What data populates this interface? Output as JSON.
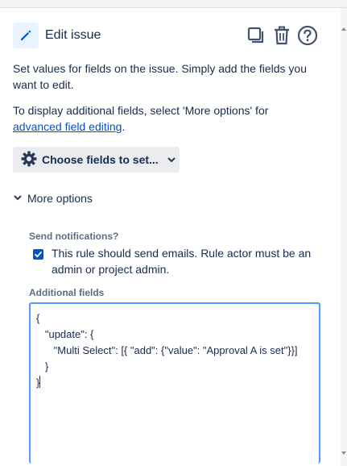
{
  "header": {
    "title": "Edit issue",
    "icons": {
      "pencil": "pencil-icon",
      "copy": "copy-icon",
      "trash": "trash-icon",
      "help": "help-icon"
    }
  },
  "intro": {
    "line1": "Set values for fields on the issue. Simply add the fields you want to edit.",
    "line2_prefix": "To display additional fields, select 'More options' for ",
    "line2_link": "advanced field editing",
    "line2_suffix": "."
  },
  "choose_fields_button": {
    "label": "Choose fields to set..."
  },
  "more_options": {
    "label": "More options",
    "expanded": true
  },
  "send_notifications": {
    "label": "Send notifications?",
    "checked": true,
    "text": "This rule should send emails. Rule actor must be an admin or project admin."
  },
  "additional_fields": {
    "label": "Additional fields",
    "value": "{\n   \"update\": {\n      \"Multi Select\": [{ \"add\": {\"value\": \"Approval A is set\"}}]\n   }\n}"
  },
  "colors": {
    "accent": "#0052cc",
    "focus": "#4c9aff",
    "text": "#172b4d",
    "muted": "#5e6c84",
    "button_bg": "#ebecf0"
  }
}
